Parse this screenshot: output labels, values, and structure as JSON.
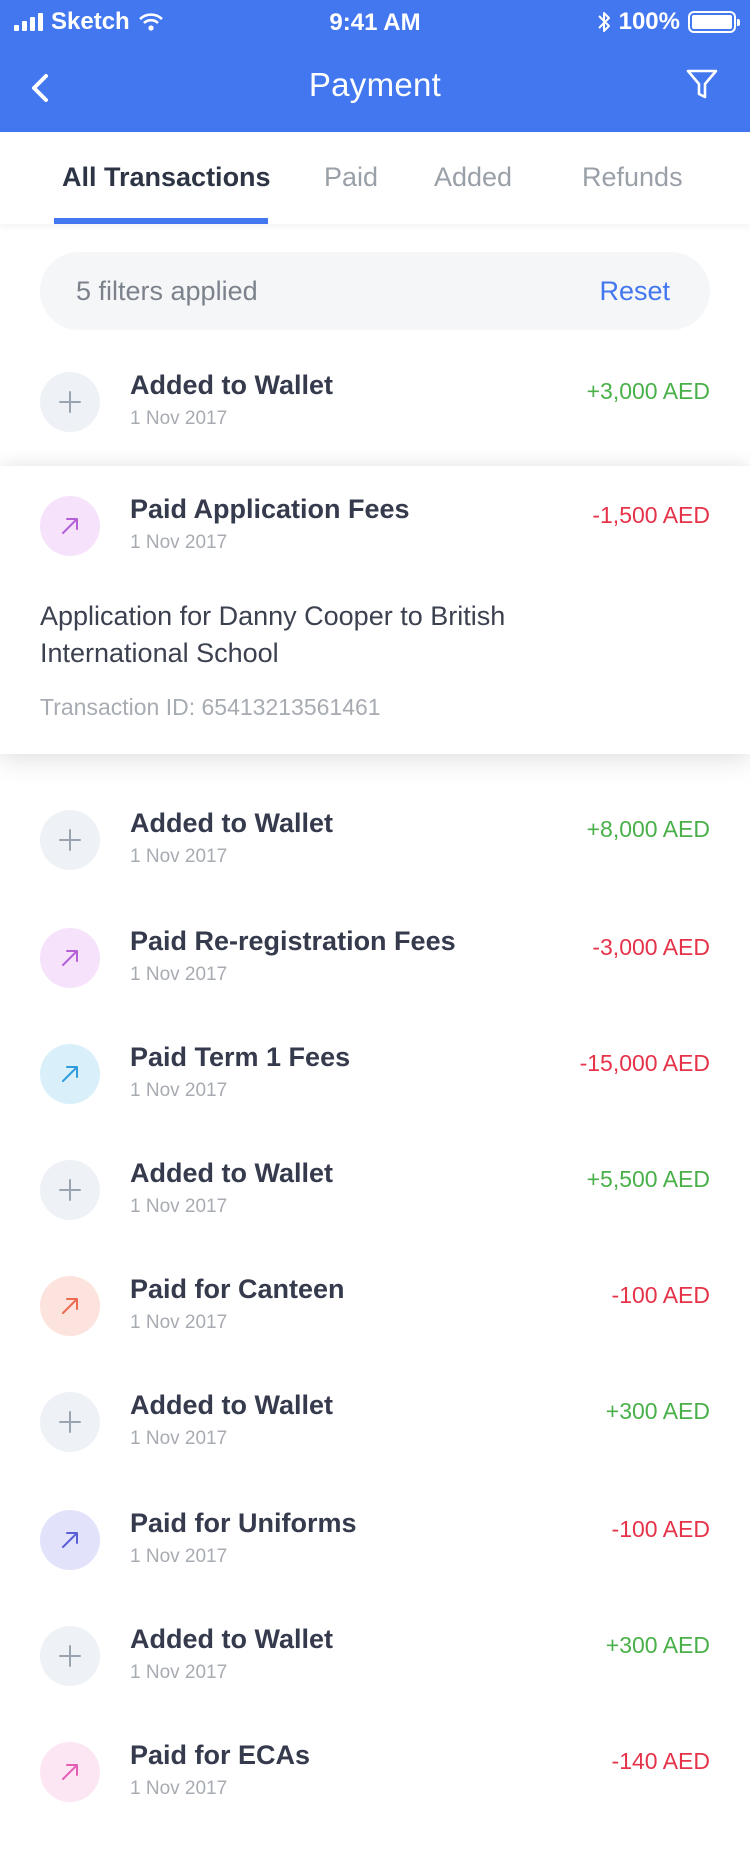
{
  "status_bar": {
    "carrier": "Sketch",
    "time": "9:41 AM",
    "battery": "100%"
  },
  "header": {
    "title": "Payment"
  },
  "tabs": [
    {
      "label": "All Transactions"
    },
    {
      "label": "Paid"
    },
    {
      "label": "Added"
    },
    {
      "label": "Refunds"
    }
  ],
  "filters": {
    "summary": "5 filters applied",
    "reset_label": "Reset"
  },
  "expanded": {
    "title": "Paid Application Fees",
    "date": "1 Nov 2017",
    "amount": "-1,500 AED",
    "description": "Application for Danny Cooper to British International School",
    "transaction_id": "Transaction ID: 65413213561461"
  },
  "transactions": [
    {
      "title": "Added to Wallet",
      "date": "1 Nov 2017",
      "amount": "+3,000 AED",
      "icon": "plus-icon",
      "color": "#eef1f5"
    },
    {
      "title": "Added to Wallet",
      "date": "1 Nov 2017",
      "amount": "+8,000 AED",
      "icon": "plus-icon",
      "color": "#eef1f5"
    },
    {
      "title": "Paid Re-registration Fees",
      "date": "1 Nov 2017",
      "amount": "-3,000 AED",
      "icon": "arrow-up-right-icon",
      "color": "#f6e2fb"
    },
    {
      "title": "Paid Term 1 Fees",
      "date": "1 Nov 2017",
      "amount": "-15,000 AED",
      "icon": "arrow-up-right-icon",
      "color": "#d9f0fb"
    },
    {
      "title": "Added to Wallet",
      "date": "1 Nov 2017",
      "amount": "+5,500 AED",
      "icon": "plus-icon",
      "color": "#eef1f5"
    },
    {
      "title": "Paid for Canteen",
      "date": "1 Nov 2017",
      "amount": "-100 AED",
      "icon": "arrow-up-right-icon",
      "color": "#fde3de"
    },
    {
      "title": "Added to Wallet",
      "date": "1 Nov 2017",
      "amount": "+300 AED",
      "icon": "plus-icon",
      "color": "#eef1f5"
    },
    {
      "title": "Paid for Uniforms",
      "date": "1 Nov 2017",
      "amount": "-100 AED",
      "icon": "arrow-up-right-icon",
      "color": "#e2e3fb"
    },
    {
      "title": "Added to Wallet",
      "date": "1 Nov 2017",
      "amount": "+300 AED",
      "icon": "plus-icon",
      "color": "#eef1f5"
    },
    {
      "title": "Paid for ECAs",
      "date": "1 Nov 2017",
      "amount": "-140 AED",
      "icon": "arrow-up-right-icon",
      "color": "#fde6f4"
    }
  ],
  "colors": {
    "accent": "#4277f0",
    "positive": "#49b04a",
    "negative": "#e5334a"
  }
}
